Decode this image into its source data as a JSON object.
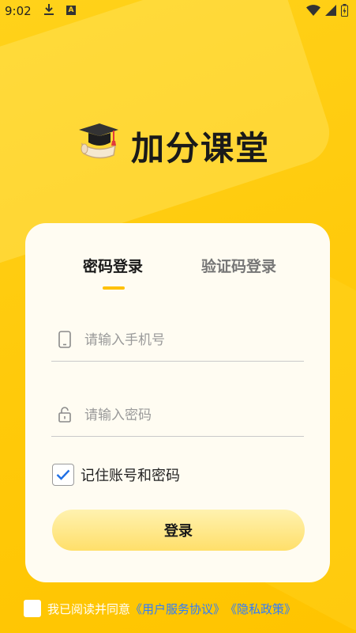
{
  "status_bar": {
    "time": "9:02",
    "download_icon": "download-icon",
    "a_badge": "A"
  },
  "logo": {
    "icon": "graduation-cap-icon",
    "text": "加分课堂"
  },
  "tabs": {
    "password_login": "密码登录",
    "code_login": "验证码登录",
    "active": "password_login"
  },
  "form": {
    "phone_placeholder": "请输入手机号",
    "phone_value": "",
    "password_placeholder": "请输入密码",
    "password_value": "",
    "remember_label": "记住账号和密码",
    "remember_checked": true,
    "login_button": "登录"
  },
  "agreement": {
    "checked": false,
    "prefix": "我已阅读并同意",
    "user_agreement": "《用户服务协议》",
    "privacy_policy": "《隐私政策》"
  },
  "colors": {
    "background": "#ffcc10",
    "accent": "#ffc107",
    "link": "#2d7cff",
    "card": "#fffcf2"
  }
}
